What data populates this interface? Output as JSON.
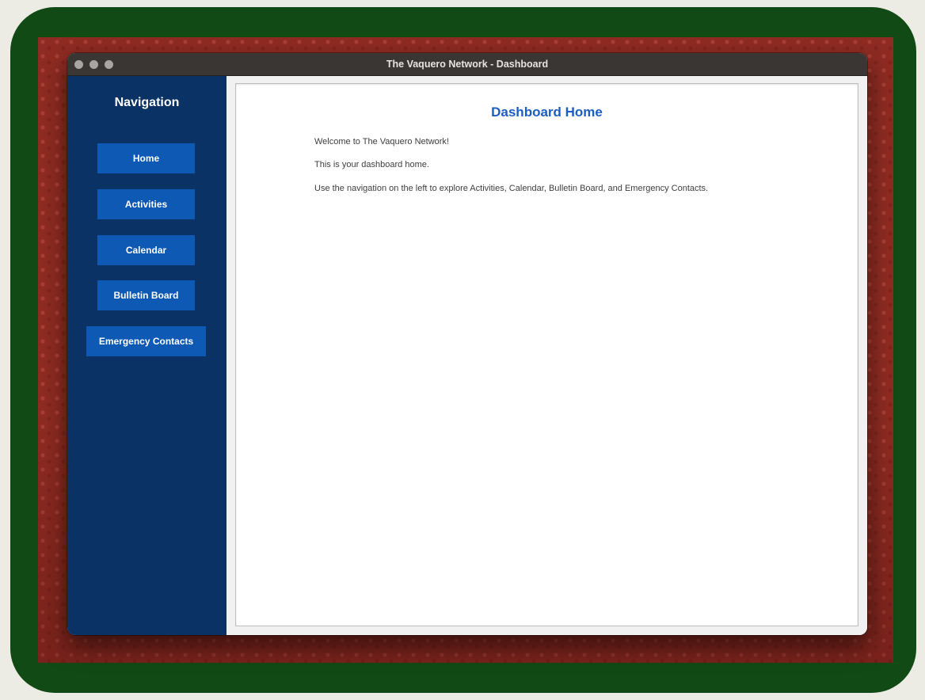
{
  "window": {
    "title": "The Vaquero Network - Dashboard"
  },
  "sidebar": {
    "heading": "Navigation",
    "items": [
      {
        "label": "Home"
      },
      {
        "label": "Activities"
      },
      {
        "label": "Calendar"
      },
      {
        "label": "Bulletin Board"
      },
      {
        "label": "Emergency Contacts"
      }
    ]
  },
  "main": {
    "title": "Dashboard Home",
    "paragraphs": [
      "Welcome to The Vaquero Network!",
      "This is your dashboard home.",
      "Use the navigation on the left to explore Activities, Calendar, Bulletin Board, and Emergency Contacts."
    ]
  },
  "colors": {
    "sidebar_bg": "#0a3265",
    "nav_button_bg": "#0d59b3",
    "title_color": "#1c5fc0",
    "frame_green": "#124a16",
    "wallpaper_red": "#8e2b22"
  }
}
